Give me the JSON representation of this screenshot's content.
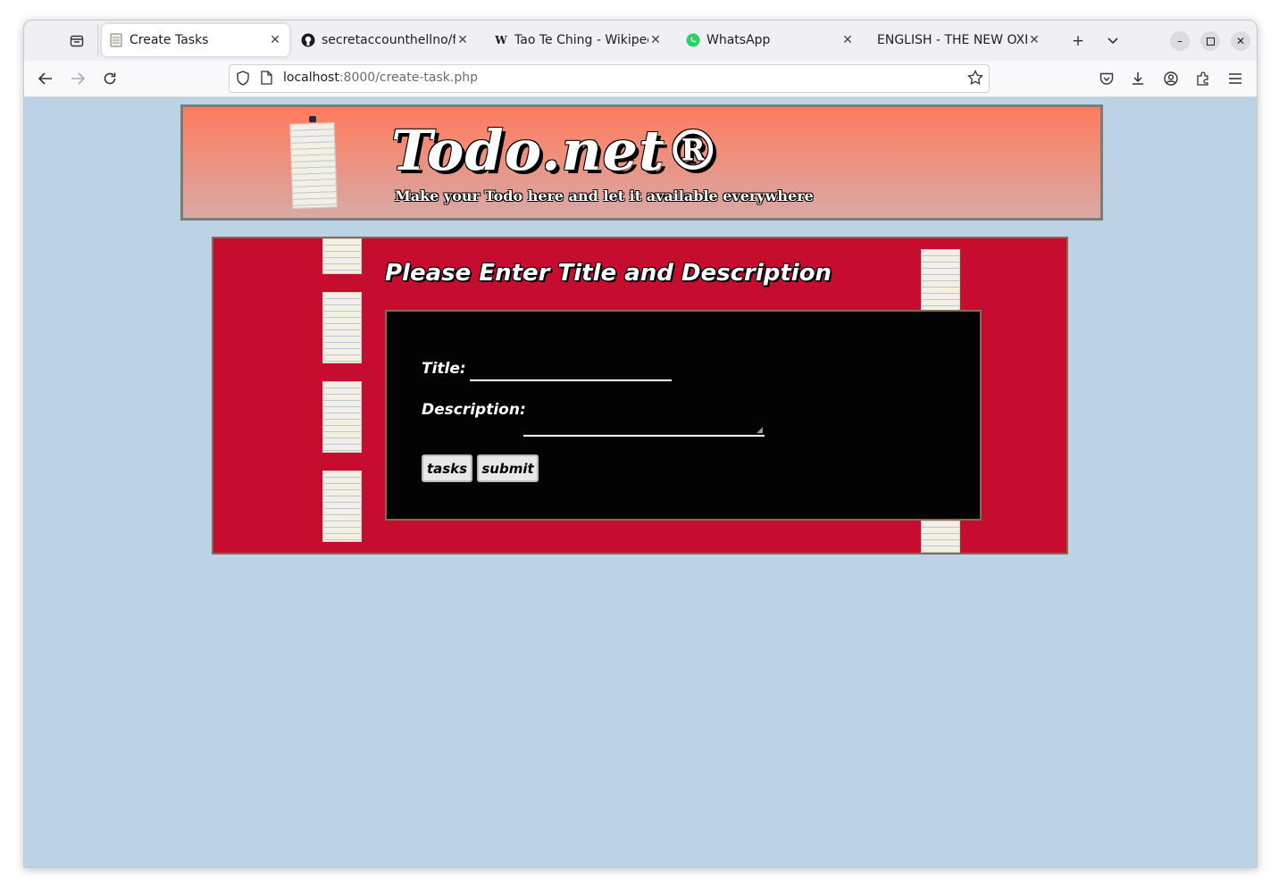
{
  "browser": {
    "tabs": [
      {
        "label": "Create Tasks",
        "icon": "document-icon",
        "active": true
      },
      {
        "label": "secretaccounthellno/fir",
        "icon": "github-icon",
        "active": false
      },
      {
        "label": "Tao Te Ching - Wikipedi",
        "icon": "wikipedia-icon",
        "active": false
      },
      {
        "label": "WhatsApp",
        "icon": "whatsapp-icon",
        "active": false
      },
      {
        "label": "ENGLISH - THE NEW OXFO",
        "icon": "none",
        "active": false
      }
    ],
    "url_host": "localhost",
    "url_rest": ":8000/create-task.php"
  },
  "header": {
    "brand": "Todo.net®",
    "tagline": "Make your Todo here and let it available everywhere"
  },
  "form": {
    "heading": "Please Enter Title and Description",
    "title_label": "Title:",
    "title_value": "",
    "description_label": "Description:",
    "description_value": "",
    "tasks_button": "tasks",
    "submit_button": "submit"
  },
  "colors": {
    "page_background": "#bcd3e6",
    "banner_gradient_top": "#ff7b5c",
    "banner_gradient_bottom": "#d8a9a6",
    "panel_background": "#c60d30",
    "form_background": "#030303"
  }
}
